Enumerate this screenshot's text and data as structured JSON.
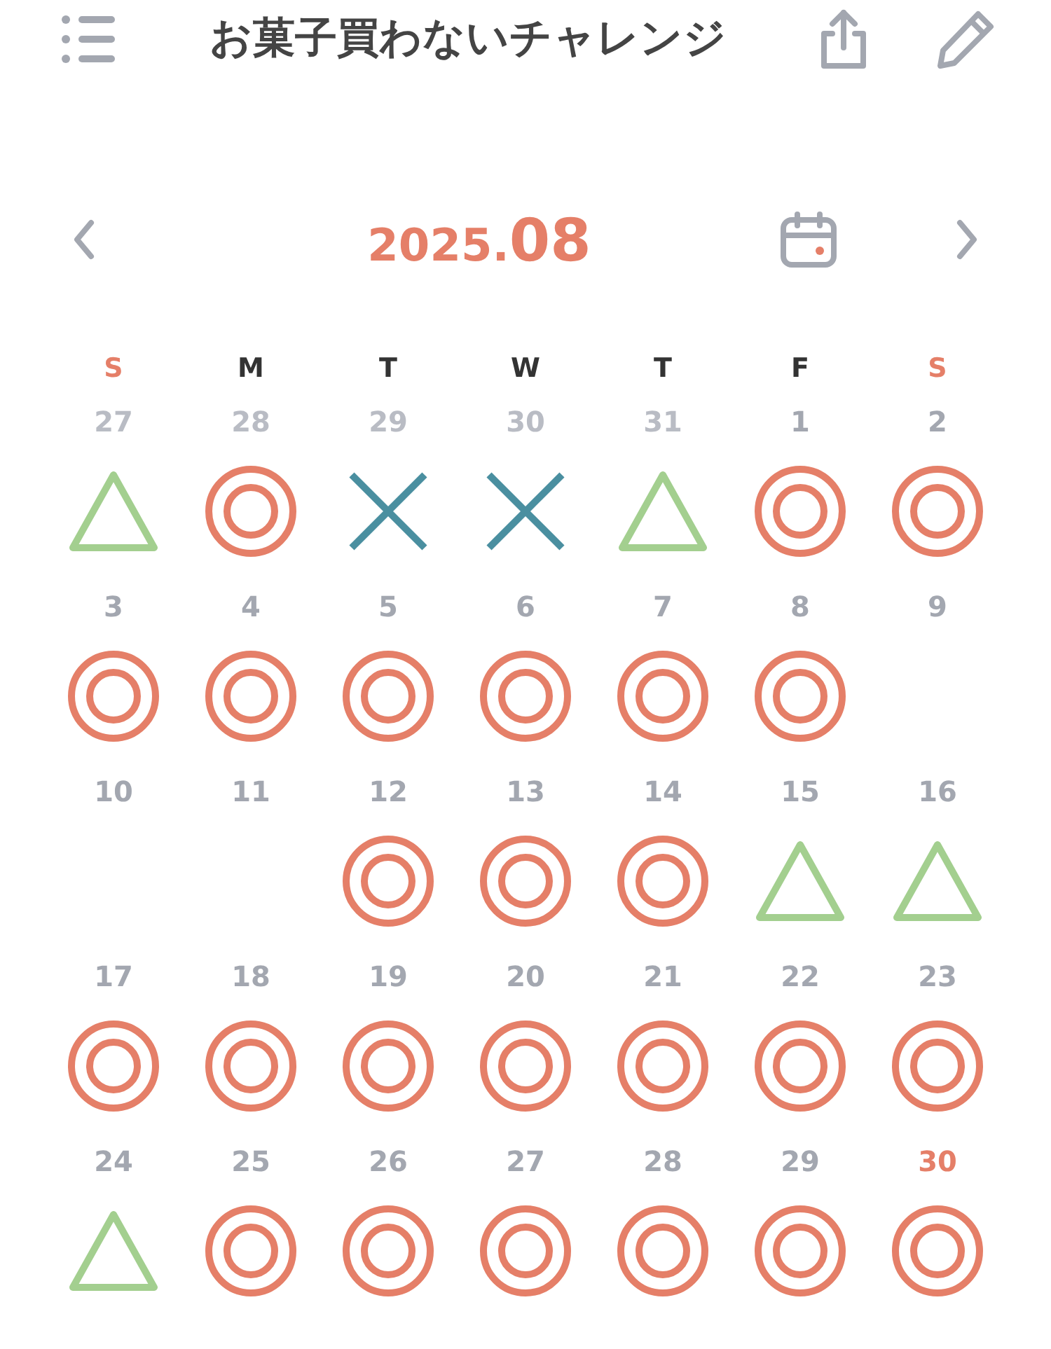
{
  "header": {
    "title": "お菓子買わないチャレンジ"
  },
  "month_nav": {
    "year": "2025.",
    "month": "08"
  },
  "weekdays": [
    {
      "label": "S",
      "weekend": true
    },
    {
      "label": "M",
      "weekend": false
    },
    {
      "label": "T",
      "weekend": false
    },
    {
      "label": "W",
      "weekend": false
    },
    {
      "label": "T",
      "weekend": false
    },
    {
      "label": "F",
      "weekend": false
    },
    {
      "label": "S",
      "weekend": true
    }
  ],
  "days": [
    {
      "day": "27",
      "muted": true,
      "today": false,
      "kind": "triangle"
    },
    {
      "day": "28",
      "muted": true,
      "today": false,
      "kind": "double_circle"
    },
    {
      "day": "29",
      "muted": true,
      "today": false,
      "kind": "cross"
    },
    {
      "day": "30",
      "muted": true,
      "today": false,
      "kind": "cross"
    },
    {
      "day": "31",
      "muted": true,
      "today": false,
      "kind": "triangle"
    },
    {
      "day": "1",
      "muted": false,
      "today": false,
      "kind": "double_circle"
    },
    {
      "day": "2",
      "muted": false,
      "today": false,
      "kind": "double_circle"
    },
    {
      "day": "3",
      "muted": false,
      "today": false,
      "kind": "double_circle"
    },
    {
      "day": "4",
      "muted": false,
      "today": false,
      "kind": "double_circle"
    },
    {
      "day": "5",
      "muted": false,
      "today": false,
      "kind": "double_circle"
    },
    {
      "day": "6",
      "muted": false,
      "today": false,
      "kind": "double_circle"
    },
    {
      "day": "7",
      "muted": false,
      "today": false,
      "kind": "double_circle"
    },
    {
      "day": "8",
      "muted": false,
      "today": false,
      "kind": "double_circle"
    },
    {
      "day": "9",
      "muted": false,
      "today": false,
      "kind": "empty"
    },
    {
      "day": "10",
      "muted": false,
      "today": false,
      "kind": "empty"
    },
    {
      "day": "11",
      "muted": false,
      "today": false,
      "kind": "empty"
    },
    {
      "day": "12",
      "muted": false,
      "today": false,
      "kind": "double_circle"
    },
    {
      "day": "13",
      "muted": false,
      "today": false,
      "kind": "double_circle"
    },
    {
      "day": "14",
      "muted": false,
      "today": false,
      "kind": "double_circle"
    },
    {
      "day": "15",
      "muted": false,
      "today": false,
      "kind": "triangle"
    },
    {
      "day": "16",
      "muted": false,
      "today": false,
      "kind": "triangle"
    },
    {
      "day": "17",
      "muted": false,
      "today": false,
      "kind": "double_circle"
    },
    {
      "day": "18",
      "muted": false,
      "today": false,
      "kind": "double_circle"
    },
    {
      "day": "19",
      "muted": false,
      "today": false,
      "kind": "double_circle"
    },
    {
      "day": "20",
      "muted": false,
      "today": false,
      "kind": "double_circle"
    },
    {
      "day": "21",
      "muted": false,
      "today": false,
      "kind": "double_circle"
    },
    {
      "day": "22",
      "muted": false,
      "today": false,
      "kind": "double_circle"
    },
    {
      "day": "23",
      "muted": false,
      "today": false,
      "kind": "double_circle"
    },
    {
      "day": "24",
      "muted": false,
      "today": false,
      "kind": "triangle"
    },
    {
      "day": "25",
      "muted": false,
      "today": false,
      "kind": "double_circle"
    },
    {
      "day": "26",
      "muted": false,
      "today": false,
      "kind": "double_circle"
    },
    {
      "day": "27",
      "muted": false,
      "today": false,
      "kind": "double_circle"
    },
    {
      "day": "28",
      "muted": false,
      "today": false,
      "kind": "double_circle"
    },
    {
      "day": "29",
      "muted": false,
      "today": false,
      "kind": "double_circle"
    },
    {
      "day": "30",
      "muted": false,
      "today": true,
      "kind": "double_circle"
    }
  ]
}
